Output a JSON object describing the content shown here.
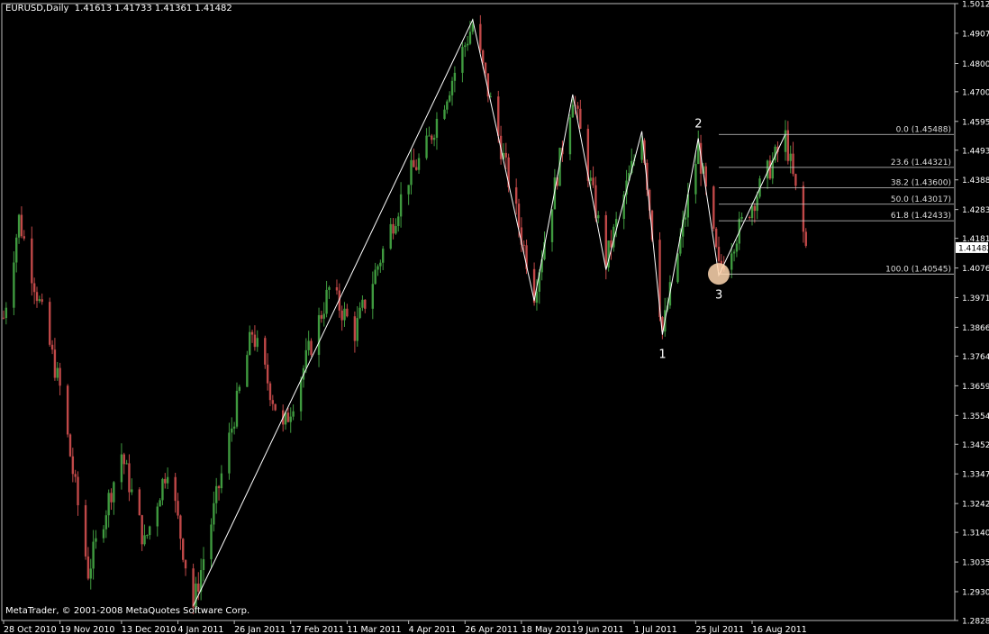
{
  "header": {
    "symbol": "EURUSD,Daily",
    "ohlc": "1.41613 1.41733 1.41361 1.41482"
  },
  "footer": {
    "copyright": "MetaTrader, © 2001-2008 MetaQuotes Software Corp."
  },
  "colors": {
    "background": "#000000",
    "up": "#3f9a3f",
    "down": "#c04848",
    "frame": "#bbbbbb",
    "text": "#ffffff",
    "price_tag": "#ffffff",
    "highlight": "#ffd7b0"
  },
  "chart_data": {
    "type": "candlestick",
    "symbol": "EURUSD",
    "timeframe": "Daily",
    "ylim": [
      1.2828,
      1.5012
    ],
    "y_ticks": [
      "1.50120",
      "1.49070",
      "1.48000",
      "1.47000",
      "1.45950",
      "1.44930",
      "1.43880",
      "1.42830",
      "1.41810",
      "1.40760",
      "1.39710",
      "1.38660",
      "1.37640",
      "1.36590",
      "1.35540",
      "1.34520",
      "1.33470",
      "1.32420",
      "1.31400",
      "1.30350",
      "1.29300",
      "1.28280"
    ],
    "x_ticks": [
      "28 Oct 2010",
      "19 Nov 2010",
      "13 Dec 2010",
      "4 Jan 2011",
      "26 Jan 2011",
      "17 Feb 2011",
      "11 Mar 2011",
      "4 Apr 2011",
      "26 Apr 2011",
      "18 May 2011",
      "9 Jun 2011",
      "1 Jul 2011",
      "25 Jul 2011",
      "16 Aug 2011"
    ],
    "last_price": "1.41482",
    "price_path": [
      [
        "28 Oct 2010",
        1.39
      ],
      [
        "3 Nov 2010",
        1.425
      ],
      [
        "19 Nov 2010",
        1.365
      ],
      [
        "30 Nov 2010",
        1.3
      ],
      [
        "13 Dec 2010",
        1.342
      ],
      [
        "22 Dec 2010",
        1.31
      ],
      [
        "31 Dec 2010",
        1.338
      ],
      [
        "10 Jan 2011",
        1.288
      ],
      [
        "2 Feb 2011",
        1.385
      ],
      [
        "14 Feb 2011",
        1.35
      ],
      [
        "4 Mar 2011",
        1.4
      ],
      [
        "14 Mar 2011",
        1.385
      ],
      [
        "4 Apr 2011",
        1.44
      ],
      [
        "10 Apr 2011",
        1.448
      ],
      [
        "29 Apr 2011",
        1.494
      ],
      [
        "23 May 2011",
        1.399
      ],
      [
        "7 Jun 2011",
        1.469
      ],
      [
        "20 Jun 2011",
        1.41
      ],
      [
        "4 Jul 2011",
        1.456
      ],
      [
        "12 Jul 2011",
        1.385
      ],
      [
        "26 Jul 2011",
        1.45
      ],
      [
        "3 Aug 2011",
        1.407
      ],
      [
        "29 Aug 2011",
        1.454
      ],
      [
        "6 Sep 2011",
        1.4148
      ]
    ],
    "zigzag": [
      [
        "10 Jan 2011",
        1.288
      ],
      [
        "29 Apr 2011",
        1.4955
      ],
      [
        "23 May 2011",
        1.396
      ],
      [
        "7 Jun 2011",
        1.469
      ],
      [
        "20 Jun 2011",
        1.407
      ],
      [
        "4 Jul 2011",
        1.456
      ],
      [
        "12 Jul 2011",
        1.384
      ],
      [
        "26 Jul 2011",
        1.4535
      ],
      [
        "3 Aug 2011",
        1.405
      ],
      [
        "29 Aug 2011",
        1.455
      ]
    ],
    "point_labels": [
      {
        "text": "1",
        "date": "12 Jul 2011",
        "price": 1.384
      },
      {
        "text": "2",
        "date": "26 Jul 2011",
        "price": 1.4535
      },
      {
        "text": "3",
        "date": "3 Aug 2011",
        "price": 1.405
      }
    ],
    "fibonacci": {
      "from_date": "3 Aug 2011",
      "levels": [
        {
          "label": "0.0 (1.45488)",
          "price": 1.45488
        },
        {
          "label": "23.6 (1.44321)",
          "price": 1.44321
        },
        {
          "label": "38.2 (1.43600)",
          "price": 1.436
        },
        {
          "label": "50.0 (1.43017)",
          "price": 1.43017
        },
        {
          "label": "61.8 (1.42433)",
          "price": 1.42433
        },
        {
          "label": "100.0 (1.40545)",
          "price": 1.40545
        }
      ]
    },
    "highlight": {
      "date": "3 Aug 2011",
      "price": 1.4055
    }
  }
}
